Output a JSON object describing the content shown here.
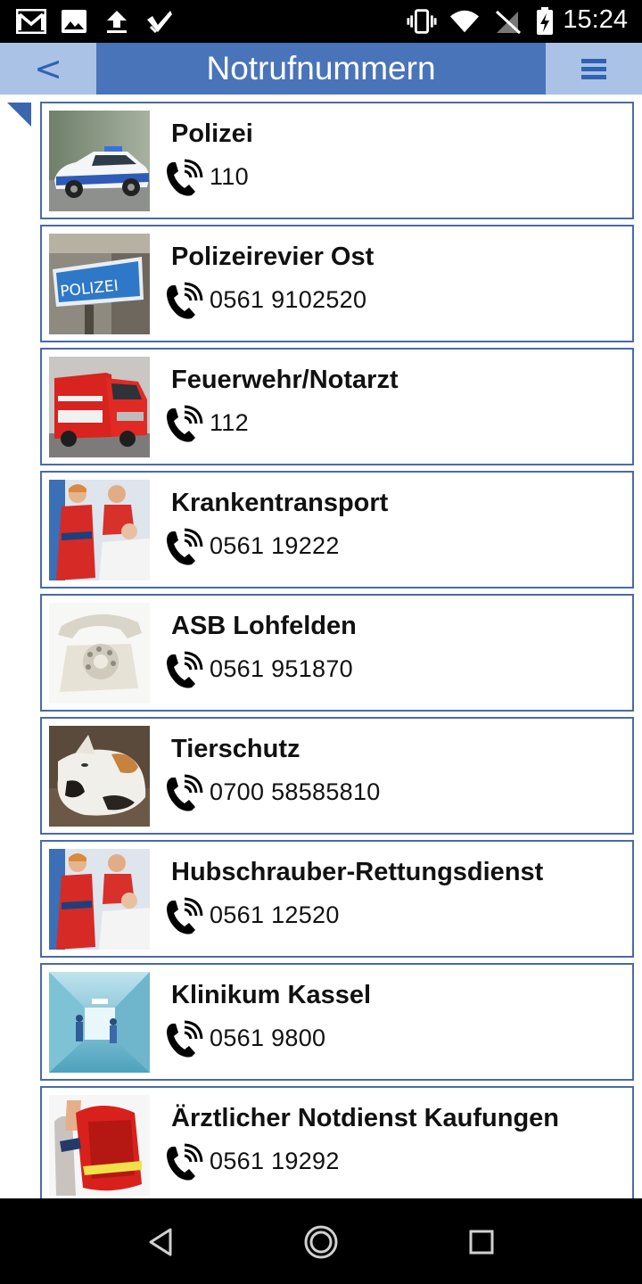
{
  "status_bar": {
    "time": "15:24",
    "left_icons": [
      "gmail-icon",
      "image-icon",
      "upload-icon",
      "check-icon"
    ],
    "right_icons": [
      "vibrate-icon",
      "wifi-icon",
      "no-sim-icon",
      "battery-charging-icon"
    ]
  },
  "header": {
    "back_label": "<",
    "title": "Notrufnummern",
    "menu_icon": "hamburger-menu-icon",
    "colors": {
      "bar": "#a9c2e6",
      "title_bg": "#4a74b9",
      "accent": "#2f62b3"
    }
  },
  "contacts": [
    {
      "name": "Polizei",
      "phone": "110",
      "image": "police-car"
    },
    {
      "name": "Polizeirevier Ost",
      "phone": "0561 9102520",
      "image": "polizei-sign",
      "image_text": "POLIZEI"
    },
    {
      "name": "Feuerwehr/Notarzt",
      "phone": "112",
      "image": "fire-truck"
    },
    {
      "name": "Krankentransport",
      "phone": "0561 19222",
      "image": "paramedics"
    },
    {
      "name": "ASB Lohfelden",
      "phone": "0561 951870",
      "image": "rotary-telephone"
    },
    {
      "name": "Tierschutz",
      "phone": "0700 58585810",
      "image": "cat"
    },
    {
      "name": "Hubschrauber-Rettungsdienst",
      "phone": "0561 12520",
      "image": "paramedics"
    },
    {
      "name": "Klinikum Kassel",
      "phone": "0561 9800",
      "image": "hospital-corridor"
    },
    {
      "name": "Ärztlicher Notdienst Kaufungen",
      "phone": "0561 19292",
      "image": "medic-backpack"
    }
  ],
  "nav_bar": {
    "buttons": [
      "back-triangle-icon",
      "home-circle-icon",
      "recents-square-icon"
    ]
  }
}
